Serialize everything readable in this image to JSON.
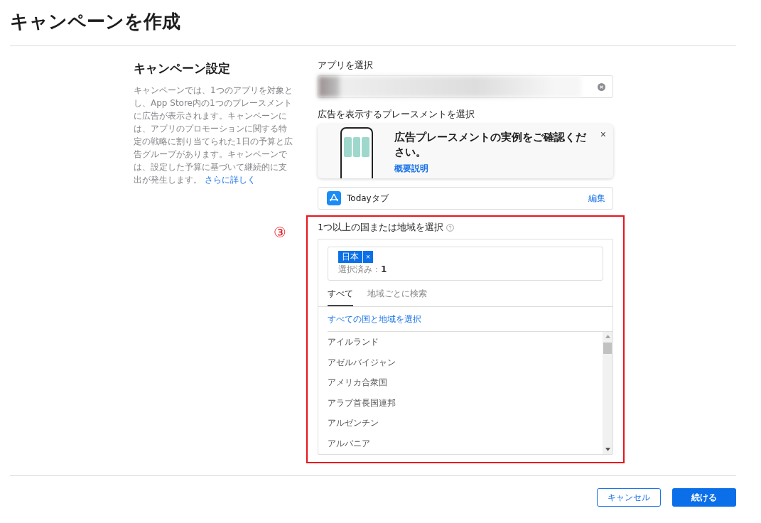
{
  "title": "キャンペーンを作成",
  "settings": {
    "heading": "キャンペーン設定",
    "description": "キャンペーンでは、1つのアプリを対象とし、App Store内の1つのプレースメントに広告が表示されます。キャンペーンには、アプリのプロモーションに関する特定の戦略に割り当てられた1日の予算と広告グループがあります。キャンペーンでは、設定した予算に基づいて継続的に支出が発生します。",
    "link": "さらに詳しく"
  },
  "app_select": {
    "label": "アプリを選択"
  },
  "placement": {
    "label": "広告を表示するプレースメントを選択",
    "banner_title": "広告プレースメントの実例をご確認ください。",
    "banner_link": "概要説明",
    "close": "×",
    "option": "Todayタブ",
    "edit": "編集"
  },
  "annotation": "③",
  "countries": {
    "label": "1つ以上の国または地域を選択",
    "chips": [
      {
        "label": "日本",
        "remove": "×"
      }
    ],
    "selected_label": "選択済み：",
    "selected_count": "1",
    "tabs": [
      {
        "label": "すべて",
        "selected": true
      },
      {
        "label": "地域ごとに検索",
        "selected": false
      }
    ],
    "select_all": "すべての国と地域を選択",
    "items": [
      "アイルランド",
      "アゼルバイジャン",
      "アメリカ合衆国",
      "アラブ首長国連邦",
      "アルゼンチン",
      "アルバニア"
    ]
  },
  "buttons": {
    "cancel": "キャンセル",
    "continue": "続ける"
  }
}
